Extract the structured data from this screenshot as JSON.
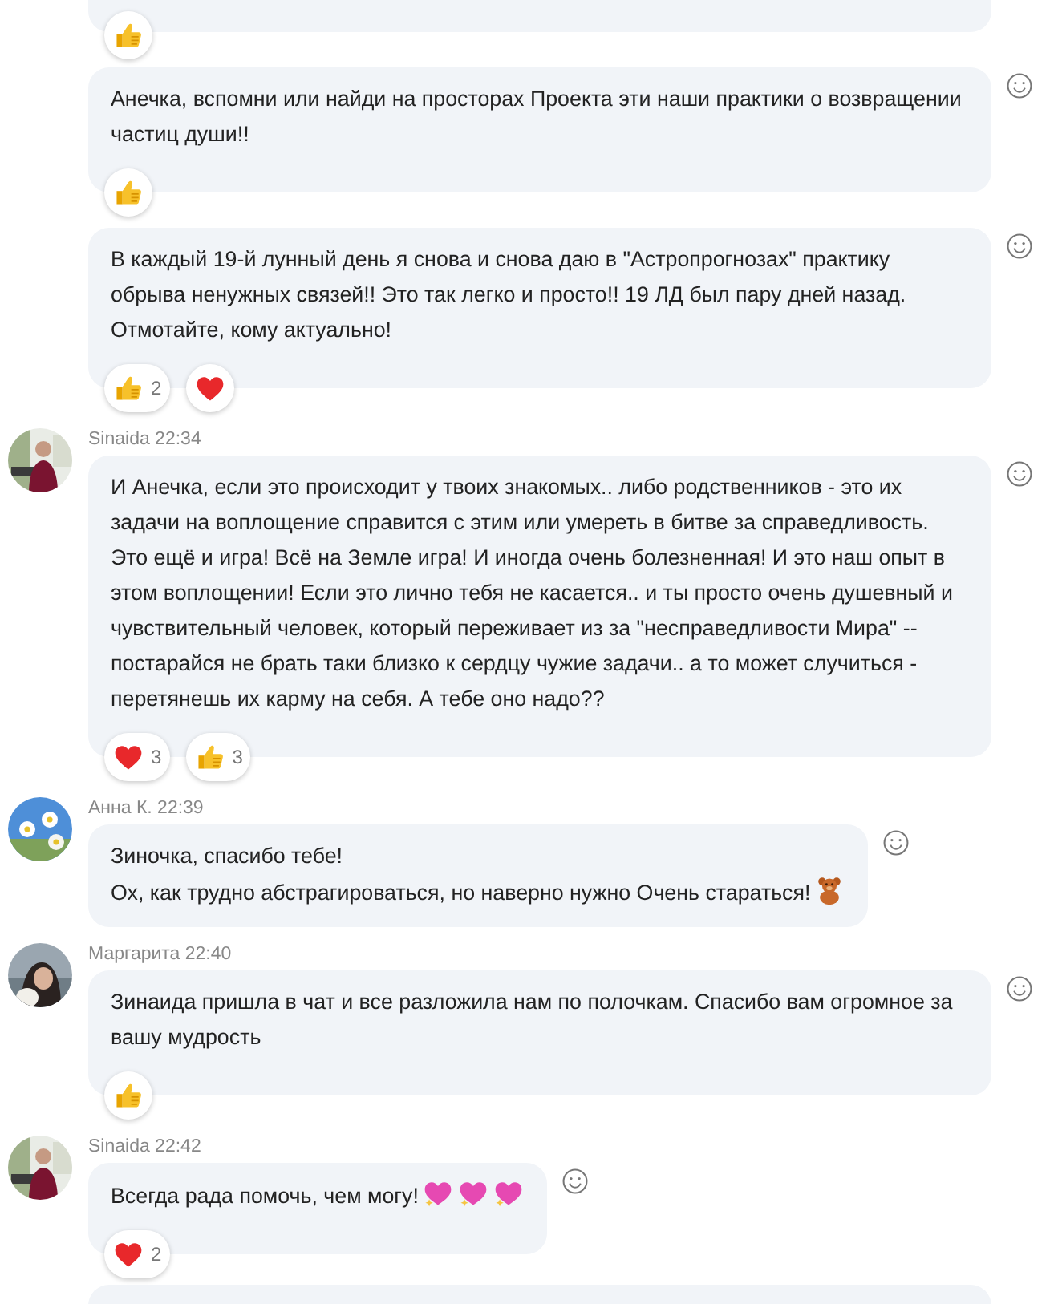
{
  "messages": [
    {
      "cut_top": true,
      "reactions": [
        {
          "kind": "like"
        }
      ]
    },
    {
      "text": "Анечка, вспомни или найди на просторах Проекта эти наши практики о возвращении частиц души!!",
      "reactions": [
        {
          "kind": "like"
        }
      ]
    },
    {
      "text": "В каждый 19-й лунный день я снова и снова даю в \"Астропрогнозах\" практику обрыва ненужных связей!! Это так легко и просто!! 19 ЛД был пару дней назад. Отмотайте, кому актуально!",
      "reactions": [
        {
          "kind": "like",
          "count": "2"
        },
        {
          "kind": "heart"
        }
      ]
    },
    {
      "author": "Sinaida",
      "time": "22:34",
      "avatar": {
        "kind": "picture"
      },
      "text": "И Анечка, если это происходит у твоих знакомых.. либо родственников - это их задачи на воплощение справится с этим или умереть в битве за справедливость. Это ещё и игра! Всё на Земле игра! И иногда очень болезненная! И это наш опыт в этом воплощении! Если это лично тебя не касается.. и ты просто очень душевный и чувствительный человек, который переживает из за \"несправедливости Мира\" -- постарайся не брать таки близко к сердцу чужие задачи.. а то может случиться - перетянешь их карму на себя. А тебе оно надо??",
      "reactions": [
        {
          "kind": "heart",
          "count": "3"
        },
        {
          "kind": "like",
          "count": "3"
        }
      ]
    },
    {
      "author": "Анна К.",
      "time": "22:39",
      "avatar": {
        "kind": "picture"
      },
      "text": "Зиночка, спасибо тебе!\nОх, как трудно абстрагироваться, но наверно нужно Очень стараться!",
      "emoji": [
        {
          "kind": "bear"
        }
      ]
    },
    {
      "author": "Маргарита",
      "time": "22:40",
      "avatar": {
        "kind": "picture"
      },
      "text": "Зинаида пришла в чат и все разложила нам по полочкам. Спасибо вам огромное за вашу мудрость",
      "reactions": [
        {
          "kind": "like"
        }
      ]
    },
    {
      "author": "Sinaida",
      "time": "22:42",
      "avatar": {
        "kind": "picture"
      },
      "text": "Всегда рада помочь, чем могу!",
      "emoji": [
        {
          "kind": "sparkle-heart"
        },
        {
          "kind": "sparkle-heart"
        },
        {
          "kind": "sparkle-heart"
        }
      ],
      "reactions": [
        {
          "kind": "heart",
          "count": "2"
        }
      ]
    }
  ],
  "more_below": true
}
